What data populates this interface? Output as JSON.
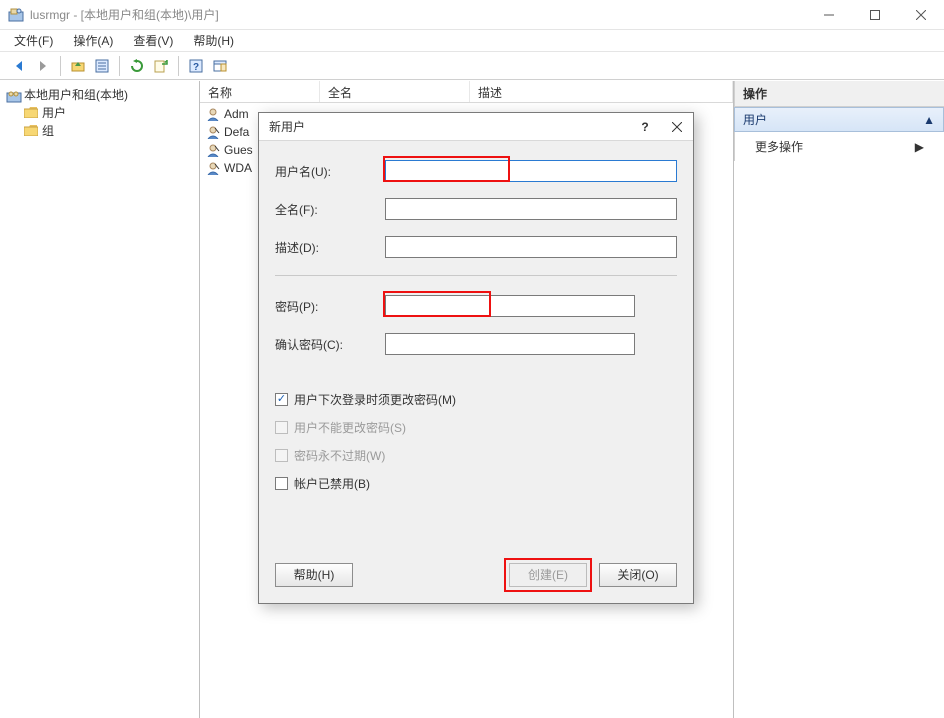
{
  "window": {
    "title": "lusrmgr - [本地用户和组(本地)\\用户]"
  },
  "menu": {
    "file": "文件(F)",
    "action": "操作(A)",
    "view": "查看(V)",
    "help": "帮助(H)"
  },
  "tree": {
    "root": "本地用户和组(本地)",
    "users": "用户",
    "groups": "组"
  },
  "list": {
    "columns": {
      "name": "名称",
      "fullname": "全名",
      "desc": "描述"
    },
    "rows": [
      {
        "name": "Adm"
      },
      {
        "name": "Defa"
      },
      {
        "name": "Gues"
      },
      {
        "name": "WDA"
      }
    ]
  },
  "actions": {
    "header": "操作",
    "section": "用户",
    "more": "更多操作"
  },
  "dialog": {
    "title": "新用户",
    "labels": {
      "username": "用户名(U):",
      "fullname": "全名(F):",
      "desc": "描述(D):",
      "password": "密码(P):",
      "confirm": "确认密码(C):"
    },
    "values": {
      "username": "",
      "fullname": "",
      "desc": "",
      "password": "",
      "confirm": ""
    },
    "checks": {
      "must_change": "用户下次登录时须更改密码(M)",
      "cannot_change": "用户不能更改密码(S)",
      "never_expire": "密码永不过期(W)",
      "disabled": "帐户已禁用(B)"
    },
    "buttons": {
      "help": "帮助(H)",
      "create": "创建(E)",
      "close": "关闭(O)"
    }
  }
}
